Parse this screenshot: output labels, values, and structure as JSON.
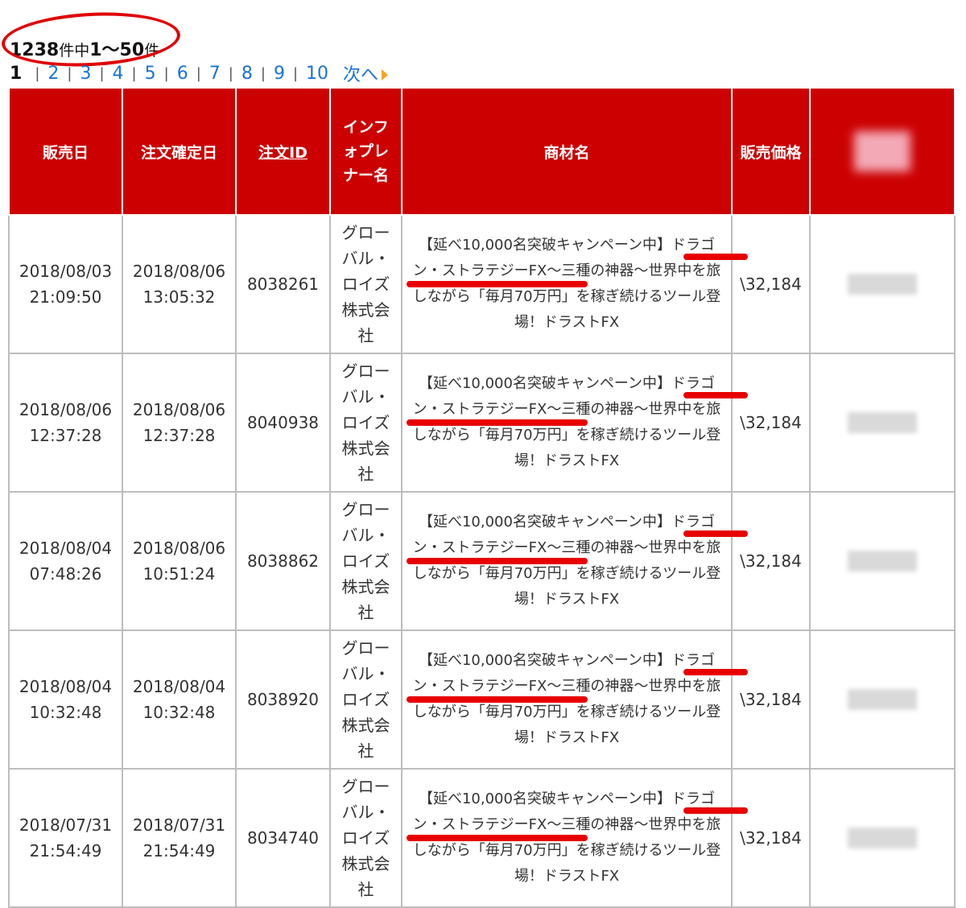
{
  "summary": {
    "total": "1238",
    "of_label": "件中",
    "range": "1〜50",
    "unit": "件"
  },
  "pagination": {
    "current": "1",
    "pages": [
      "2",
      "3",
      "4",
      "5",
      "6",
      "7",
      "8",
      "9",
      "10"
    ],
    "next_label": "次へ"
  },
  "table": {
    "headers": [
      "販売日",
      "注文確定日",
      "注文ID",
      "インフォプレナー名",
      "商材名",
      "販売価格",
      ""
    ],
    "rows": [
      {
        "sale_date": "2018/08/03",
        "sale_time": "21:09:50",
        "confirm_date": "2018/08/06",
        "confirm_time": "13:05:32",
        "order_id": "8038261",
        "infopreneur": "グローバル・ロイズ株式会社",
        "product": "【延べ10,000名突破キャンペーン中】ドラゴン・ストラテジーFX〜三種の神器〜世界中を旅しながら「毎月70万円」を稼ぎ続けるツール登場！ドラストFX",
        "price": "\\32,184"
      },
      {
        "sale_date": "2018/08/06",
        "sale_time": "12:37:28",
        "confirm_date": "2018/08/06",
        "confirm_time": "12:37:28",
        "order_id": "8040938",
        "infopreneur": "グローバル・ロイズ株式会社",
        "product": "【延べ10,000名突破キャンペーン中】ドラゴン・ストラテジーFX〜三種の神器〜世界中を旅しながら「毎月70万円」を稼ぎ続けるツール登場！ドラストFX",
        "price": "\\32,184"
      },
      {
        "sale_date": "2018/08/04",
        "sale_time": "07:48:26",
        "confirm_date": "2018/08/06",
        "confirm_time": "10:51:24",
        "order_id": "8038862",
        "infopreneur": "グローバル・ロイズ株式会社",
        "product": "【延べ10,000名突破キャンペーン中】ドラゴン・ストラテジーFX〜三種の神器〜世界中を旅しながら「毎月70万円」を稼ぎ続けるツール登場！ドラストFX",
        "price": "\\32,184"
      },
      {
        "sale_date": "2018/08/04",
        "sale_time": "10:32:48",
        "confirm_date": "2018/08/04",
        "confirm_time": "10:32:48",
        "order_id": "8038920",
        "infopreneur": "グローバル・ロイズ株式会社",
        "product": "【延べ10,000名突破キャンペーン中】ドラゴン・ストラテジーFX〜三種の神器〜世界中を旅しながら「毎月70万円」を稼ぎ続けるツール登場！ドラストFX",
        "price": "\\32,184"
      },
      {
        "sale_date": "2018/07/31",
        "sale_time": "21:54:49",
        "confirm_date": "2018/07/31",
        "confirm_time": "21:54:49",
        "order_id": "8034740",
        "infopreneur": "グローバル・ロイズ株式会社",
        "product": "【延べ10,000名突破キャンペーン中】ドラゴン・ストラテジーFX〜三種の神器〜世界中を旅しながら「毎月70万円」を稼ぎ続けるツール登場！ドラストFX",
        "price": "\\32,184"
      }
    ]
  },
  "colors": {
    "header_bg": "#cc0000",
    "annotation": "#e80000",
    "link": "#1a73d9"
  }
}
